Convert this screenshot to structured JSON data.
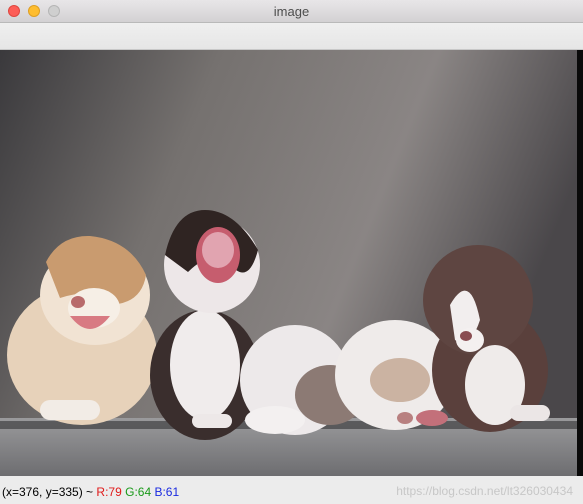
{
  "window": {
    "title": "image"
  },
  "status": {
    "coords": "(x=376, y=335) ~",
    "r_text": "R:79",
    "g_text": "G:64",
    "b_text": "B:61",
    "watermark": "https://blog.csdn.net/lt326030434"
  },
  "colors": {
    "r": "#e01a1a",
    "g": "#1a9a1a",
    "b": "#1a2ae0"
  },
  "image_content": {
    "subject": "five puppies on grey background",
    "icon": "puppies-photo"
  }
}
